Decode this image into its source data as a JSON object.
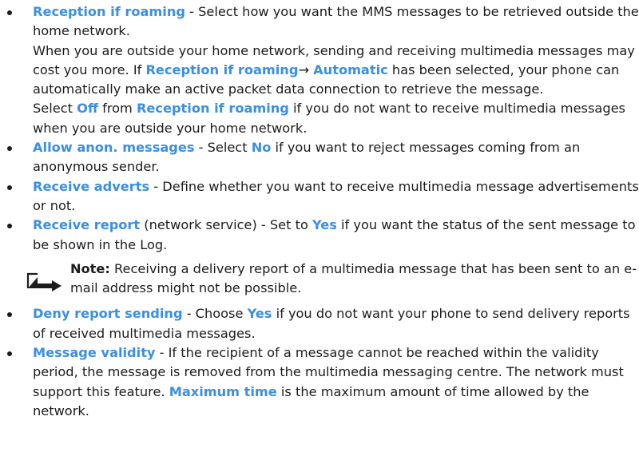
{
  "items": [
    {
      "term": "Reception if roaming",
      "para1": " - Select how you want the MMS messages to be retrieved outside the home network.",
      "para2_a": "When you are outside your home network, sending and receiving multimedia messages may cost you more. If ",
      "para2_h1": "Reception if roaming",
      "para2_arrow": "→ ",
      "para2_h2": "Automatic",
      "para2_b": " has been selected, your phone can automatically make an active packet data connection to retrieve the message.",
      "para3_a": "Select ",
      "para3_h1": "Off",
      "para3_b": " from ",
      "para3_h2": "Reception if roaming",
      "para3_c": " if you do not want to receive multimedia messages when you are outside your home network."
    },
    {
      "term": "Allow anon. messages",
      "text_a": " - Select ",
      "h1": "No",
      "text_b": " if you want to reject messages coming from an anonymous sender."
    },
    {
      "term": "Receive adverts",
      "text_a": " - Define whether you want to receive multimedia message advertisements or not."
    },
    {
      "term": "Receive report",
      "text_a": " (network service) - Set to ",
      "h1": "Yes",
      "text_b": " if you want the status of the sent message to be shown in the Log."
    },
    {
      "term": "Deny report sending",
      "text_a": " - Choose ",
      "h1": "Yes",
      "text_b": " if you do not want your phone to send delivery reports of received multimedia messages."
    },
    {
      "term": "Message validity",
      "text_a": " - If the recipient of a message cannot be reached within the validity period, the message is removed from the multimedia messaging centre. The network must support this feature. ",
      "h1": "Maximum time",
      "text_b": " is the maximum amount of time allowed by the network."
    }
  ],
  "note": {
    "label": "Note:",
    "text": " Receiving a delivery report of a multimedia message that has been sent to an e-mail address might not be possible."
  },
  "colors": {
    "highlight": "#3a8ee6",
    "text": "#1c1c1c"
  }
}
